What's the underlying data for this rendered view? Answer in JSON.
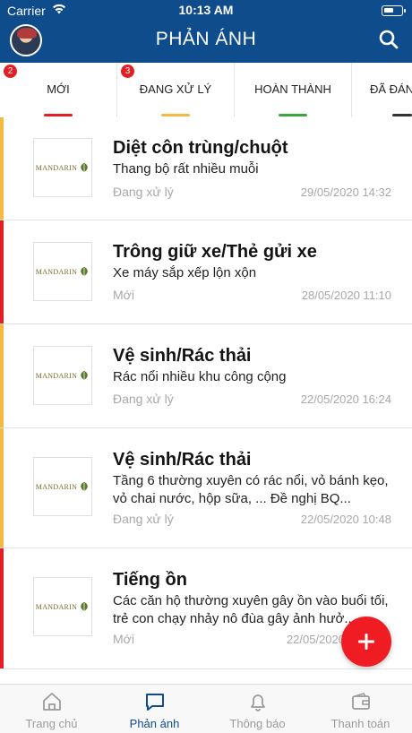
{
  "status_bar": {
    "carrier": "Carrier",
    "time": "10:13 AM"
  },
  "header": {
    "title": "PHẢN ÁNH"
  },
  "tabs": [
    {
      "label": "MỚI",
      "badge": "2",
      "underline_color": "#e31e24"
    },
    {
      "label": "ĐANG XỬ LÝ",
      "badge": "3",
      "underline_color": "#f5b942"
    },
    {
      "label": "HOÀN THÀNH",
      "badge": "",
      "underline_color": "#3aa83a"
    },
    {
      "label": "ĐÃ ĐÁN",
      "badge": "",
      "underline_color": "#333333"
    }
  ],
  "items": [
    {
      "title": "Diệt côn trùng/chuột",
      "description": "Thang bộ rất nhiều muỗi",
      "status": "Đang xử lý",
      "datetime": "29/05/2020 14:32",
      "bar_color": "#f5b942",
      "logo_text": "MANDARIN"
    },
    {
      "title": "Trông giữ xe/Thẻ gửi xe",
      "description": "Xe máy sắp xếp lộn xộn",
      "status": "Mới",
      "datetime": "28/05/2020 11:10",
      "bar_color": "#e31e24",
      "logo_text": "MANDARIN"
    },
    {
      "title": "Vệ sinh/Rác thải",
      "description": "Rác nổi nhiều khu công cộng",
      "status": "Đang xử lý",
      "datetime": "22/05/2020 16:24",
      "bar_color": "#f5b942",
      "logo_text": "MANDARIN"
    },
    {
      "title": "Vệ sinh/Rác thải",
      "description": "Tầng 6 thường xuyên có rác nổi, vỏ bánh kẹo, vỏ chai nước, hộp sữa, ... Đề nghị BQ...",
      "status": "Đang xử lý",
      "datetime": "22/05/2020 10:48",
      "bar_color": "#f5b942",
      "logo_text": "MANDARIN"
    },
    {
      "title": "Tiếng ồn",
      "description": "Các căn hộ thường xuyên gây ồn vào buổi tối, trẻ con chạy nhảy nô đùa gây ảnh hưở...",
      "status": "Mới",
      "datetime": "22/05/2020",
      "bar_color": "#e31e24",
      "logo_text": "MANDARIN"
    }
  ],
  "bottom_nav": [
    {
      "label": "Trang chủ",
      "icon": "home-icon",
      "active": false
    },
    {
      "label": "Phản ánh",
      "icon": "chat-icon",
      "active": true
    },
    {
      "label": "Thông báo",
      "icon": "bell-icon",
      "active": false
    },
    {
      "label": "Thanh toán",
      "icon": "wallet-icon",
      "active": false
    }
  ],
  "colors": {
    "primary": "#0f4c8c",
    "accent": "#ef1c24",
    "new": "#e31e24",
    "processing": "#f5b942",
    "done": "#3aa83a"
  }
}
